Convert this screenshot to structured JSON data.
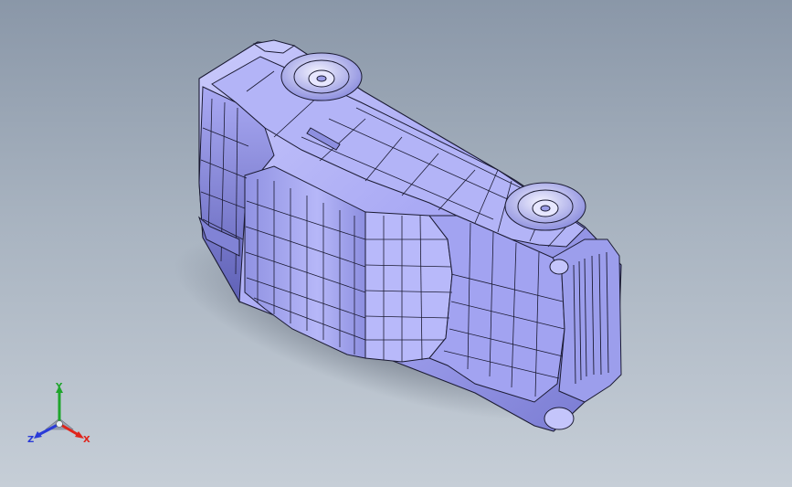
{
  "viewport": {
    "background_top": "#8a97a8",
    "background_bottom": "#c6ced7"
  },
  "model": {
    "face_color": "#a8a8f4",
    "face_shade": "#6e70c8",
    "edge_color": "#1b1b33",
    "shadow_color": "#5b6473"
  },
  "triad": {
    "x_label": "X",
    "y_label": "Y",
    "z_label": "Z",
    "x_color": "#e0241b",
    "y_color": "#1fa52c",
    "z_color": "#2a3bd8"
  }
}
